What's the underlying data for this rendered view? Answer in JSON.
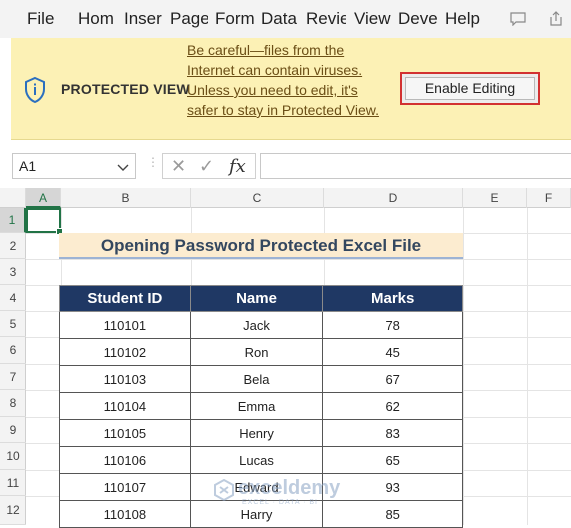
{
  "ribbon": {
    "tabs": [
      "File",
      "Hom",
      "Inser",
      "Page",
      "Form",
      "Data",
      "Revie",
      "View",
      "Deve",
      "Help"
    ]
  },
  "protected_view": {
    "title": "PROTECTED VIEW",
    "message": "Be careful—files from the Internet can contain viruses. Unless you need to edit, it's safer to stay in Protected View.",
    "button_label": "Enable Editing"
  },
  "formula_bar": {
    "name_box": "A1",
    "fx_label": "fx",
    "formula": ""
  },
  "grid": {
    "columns": [
      "A",
      "B",
      "C",
      "D",
      "E",
      "F"
    ],
    "rows": [
      "1",
      "2",
      "3",
      "4",
      "5",
      "6",
      "7",
      "8",
      "9",
      "10",
      "11",
      "12"
    ],
    "selected_cell": "A1"
  },
  "sheet": {
    "title": "Opening Password Protected Excel File",
    "table": {
      "headers": [
        "Student ID",
        "Name",
        "Marks"
      ],
      "rows": [
        [
          "110101",
          "Jack",
          "78"
        ],
        [
          "110102",
          "Ron",
          "45"
        ],
        [
          "110103",
          "Bela",
          "67"
        ],
        [
          "110104",
          "Emma",
          "62"
        ],
        [
          "110105",
          "Henry",
          "83"
        ],
        [
          "110106",
          "Lucas",
          "65"
        ],
        [
          "110107",
          "Edward",
          "93"
        ],
        [
          "110108",
          "Harry",
          "85"
        ]
      ]
    }
  },
  "watermark": {
    "name": "exceldemy",
    "tagline": "EXCEL · DATA · BI"
  },
  "colors": {
    "accent_green": "#217346",
    "header_navy": "#1f3864",
    "pv_bar": "#fcf1b5",
    "highlight_red": "#d23131"
  }
}
